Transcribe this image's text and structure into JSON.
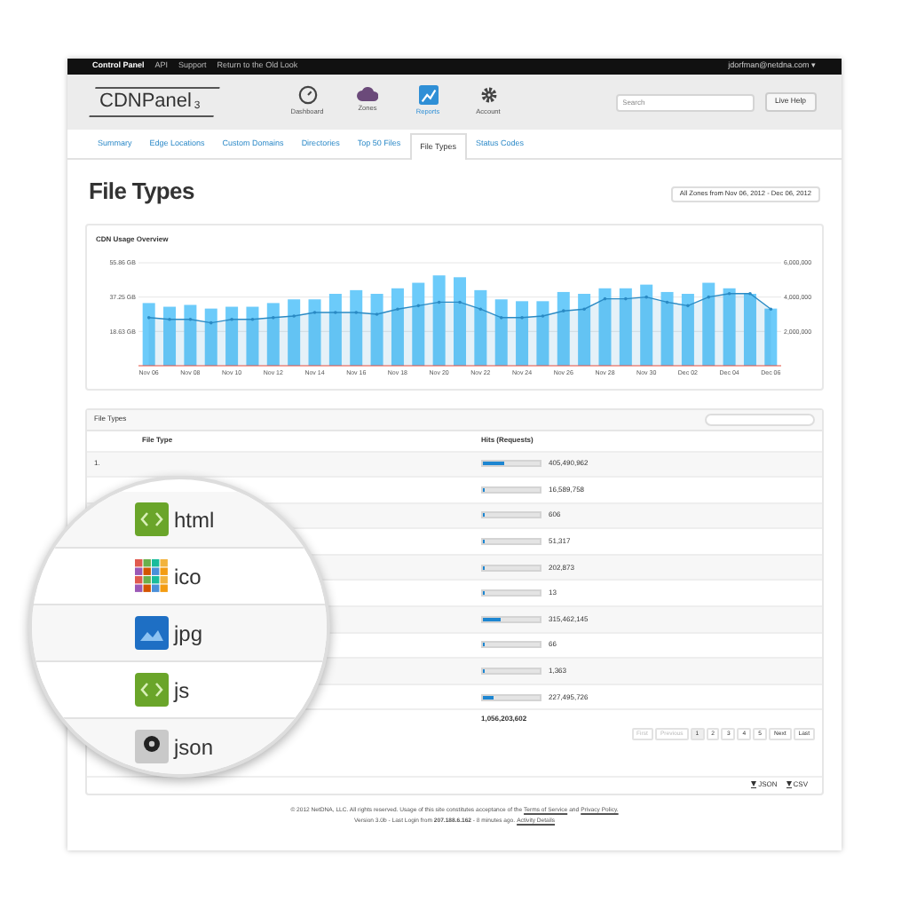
{
  "top_bar": {
    "links": [
      {
        "label": "Control Panel",
        "selected": true
      },
      {
        "label": "API",
        "selected": false
      },
      {
        "label": "Support",
        "selected": false
      },
      {
        "label": "Return to the Old Look",
        "selected": false
      }
    ],
    "user": "jdorfman@netdna.com ▾"
  },
  "header": {
    "logo": "CDNPanel",
    "logo_version": "3",
    "nav": [
      {
        "label": "Dashboard",
        "kind": "dashboard",
        "selected": false
      },
      {
        "label": "Zones",
        "kind": "zones",
        "selected": false
      },
      {
        "label": "Reports",
        "kind": "reports",
        "selected": true
      },
      {
        "label": "Account",
        "kind": "account",
        "selected": false
      }
    ],
    "search": {
      "placeholder": "Search"
    },
    "help_button": "Live Help"
  },
  "tabs": [
    {
      "label": "Summary",
      "selected": false
    },
    {
      "label": "Edge Locations",
      "selected": false
    },
    {
      "label": "Custom Domains",
      "selected": false
    },
    {
      "label": "Directories",
      "selected": false
    },
    {
      "label": "Top 50 Files",
      "selected": false
    },
    {
      "label": "File Types",
      "selected": true
    },
    {
      "label": "Status Codes",
      "selected": false
    }
  ],
  "page_title": "File Types",
  "date_select": "All Zones from Nov 06, 2012 - Dec 06, 2012",
  "chart_card": {
    "chart_data": {
      "type": "bar",
      "title": "CDN Usage Overview",
      "categories": [
        "Nov 06",
        null,
        "Nov 08",
        null,
        "Nov 10",
        null,
        "Nov 12",
        null,
        "Nov 14",
        null,
        "Nov 16",
        null,
        "Nov 18",
        null,
        "Nov 20",
        null,
        "Nov 22",
        null,
        "Nov 24",
        null,
        "Nov 26",
        null,
        "Nov 28",
        null,
        "Nov 30",
        null,
        "Dec 02",
        null,
        "Dec 04",
        null,
        "Dec 06"
      ],
      "ylim": [
        0,
        55.86
      ],
      "y2lim": [
        0,
        6000000
      ],
      "yticks": [
        {
          "value": 18.63,
          "label": "18.63 GB"
        },
        {
          "value": 37.25,
          "label": "37.25 GB"
        },
        {
          "value": 55.86,
          "label": "55.86 GB"
        }
      ],
      "y2ticks": [
        {
          "value": 2000000,
          "label": "2,000,000"
        },
        {
          "value": 4000000,
          "label": "4,000,000"
        },
        {
          "value": 6000000,
          "label": "6,000,000"
        }
      ],
      "series": [
        {
          "color": "#6ccbfa",
          "values": [
            34,
            32,
            33,
            31,
            32,
            32,
            34,
            36,
            36,
            39,
            41,
            39,
            42,
            45,
            49,
            48,
            41,
            36,
            35,
            35,
            40,
            39,
            42,
            42,
            44,
            40,
            39,
            45,
            42,
            39,
            31
          ]
        },
        {
          "color": "#2a8ac4",
          "axis": "y2",
          "type": "area",
          "values": [
            2800000,
            2700000,
            2700000,
            2500000,
            2700000,
            2700000,
            2800000,
            2900000,
            3100000,
            3100000,
            3100000,
            3000000,
            3300000,
            3500000,
            3700000,
            3700000,
            3300000,
            2800000,
            2800000,
            2900000,
            3200000,
            3300000,
            3900000,
            3900000,
            4000000,
            3700000,
            3500000,
            4000000,
            4200000,
            4200000,
            3300000
          ]
        }
      ]
    }
  },
  "table": {
    "title": "File Types",
    "columns": [
      "File Type",
      "Hits (Requests)"
    ],
    "rows": [
      {
        "number": "1.",
        "hits": "405,490,962",
        "level": 0.38
      },
      {
        "hits": "16,589,758",
        "level": 0.02
      },
      {
        "hits": "606",
        "level": 0
      },
      {
        "hits": "51,317",
        "level": 0
      },
      {
        "hits": "202,873",
        "level": 0
      },
      {
        "hits": "13",
        "level": 0
      },
      {
        "hits": "315,462,145",
        "level": 0.3
      },
      {
        "hits": "66",
        "level": 0
      },
      {
        "hits": "1,363",
        "level": 0
      },
      {
        "hits": "227,495,726",
        "level": 0.2
      }
    ],
    "total": "1,056,203,602",
    "pagination": [
      {
        "label": "First",
        "disabled": true,
        "selected": false
      },
      {
        "label": "Previous",
        "disabled": true,
        "selected": false
      },
      {
        "label": "1",
        "disabled": false,
        "selected": true
      },
      {
        "label": "2",
        "disabled": false,
        "selected": false
      },
      {
        "label": "3",
        "disabled": false,
        "selected": false
      },
      {
        "label": "4",
        "disabled": false,
        "selected": false
      },
      {
        "label": "5",
        "disabled": false,
        "selected": false
      },
      {
        "label": "Next",
        "disabled": false,
        "selected": false
      },
      {
        "label": "Last",
        "disabled": false,
        "selected": false
      }
    ],
    "exports": [
      "JSON",
      "CSV"
    ]
  },
  "magnifier": {
    "rows": [
      {
        "name": "html",
        "kind": "code"
      },
      {
        "name": "ico",
        "kind": "mosaic"
      },
      {
        "name": "jpg",
        "kind": "image"
      },
      {
        "name": "js",
        "kind": "code"
      },
      {
        "name": "json",
        "kind": "json"
      }
    ]
  },
  "footer": {
    "line_1": "© 2012 NetDNA, LLC. All rights reserved. Usage of this site constitutes acceptance of the",
    "terms_link": "Terms of Service",
    "and": "and",
    "privacy_link": "Privacy Policy.",
    "line_2": "Version 3.0b - Last Login from **207.188.6.162** - 8 minutes ago.",
    "activity_link": "Activity Details"
  }
}
